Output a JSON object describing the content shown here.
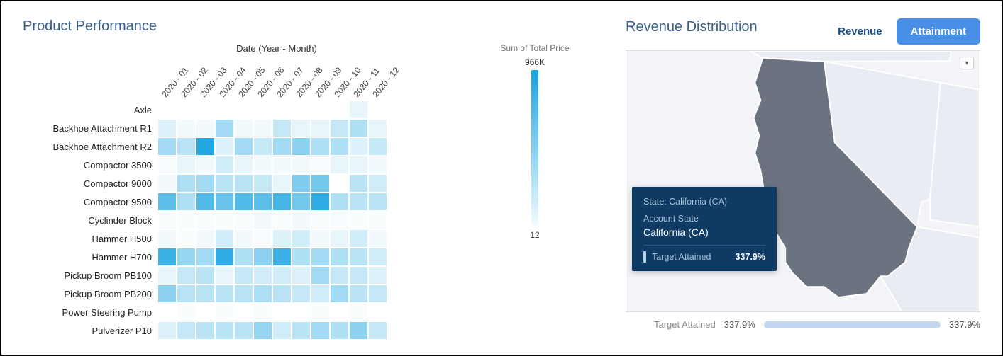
{
  "left_title": "Product Performance",
  "right_title": "Revenue Distribution",
  "toggle": {
    "revenue": "Revenue",
    "attainment": "Attainment"
  },
  "legend": {
    "title": "Sum of Total Price",
    "max": "966K",
    "min": "12"
  },
  "heatmap_top": "Date (Year - Month)",
  "x_labels": [
    "2020 - 01",
    "2020 - 02",
    "2020 - 03",
    "2020 - 04",
    "2020 - 05",
    "2020 - 06",
    "2020 - 07",
    "2020 - 08",
    "2020 - 09",
    "2020 - 10",
    "2020 - 11",
    "2020 - 12"
  ],
  "products": [
    "Axle",
    "Backhoe Attachment R1",
    "Backhoe Attachment R2",
    "Compactor 3500",
    "Compactor 9000",
    "Compactor 9500",
    "Cyclinder Block",
    "Hammer H500",
    "Hammer H700",
    "Pickup Broom PB100",
    "Pickup Broom PB200",
    "Power Steering Pump",
    "Pulverizer P10"
  ],
  "tooltip": {
    "state_line": "State: California (CA)",
    "account_label": "Account State",
    "account_value": "California (CA)",
    "metric_label": "Target Attained",
    "metric_value": "337.9%"
  },
  "bottom": {
    "label": "Target Attained",
    "left": "337.9%",
    "right": "337.9%"
  },
  "chart_data": [
    {
      "type": "heatmap",
      "title": "Product Performance",
      "xlabel": "Date (Year - Month)",
      "ylabel": "",
      "legend_title": "Sum of Total Price",
      "value_range": [
        12,
        966000
      ],
      "x": [
        "2020-01",
        "2020-02",
        "2020-03",
        "2020-04",
        "2020-05",
        "2020-06",
        "2020-07",
        "2020-08",
        "2020-09",
        "2020-10",
        "2020-11",
        "2020-12"
      ],
      "y": [
        "Axle",
        "Backhoe Attachment R1",
        "Backhoe Attachment R2",
        "Compactor 3500",
        "Compactor 9000",
        "Compactor 9500",
        "Cyclinder Block",
        "Hammer H500",
        "Hammer H700",
        "Pickup Broom PB100",
        "Pickup Broom PB200",
        "Power Steering Pump",
        "Pulverizer P10"
      ],
      "z_intensity_0to1": [
        [
          0.0,
          0.0,
          0.0,
          0.0,
          0.0,
          0.0,
          0.0,
          0.0,
          0.0,
          0.0,
          0.1,
          0.0
        ],
        [
          0.15,
          0.05,
          0.05,
          0.4,
          0.05,
          0.05,
          0.25,
          0.1,
          0.1,
          0.25,
          0.35,
          0.1
        ],
        [
          0.4,
          0.3,
          0.95,
          0.15,
          0.4,
          0.25,
          0.4,
          0.5,
          0.35,
          0.35,
          0.15,
          0.25
        ],
        [
          0.03,
          0.1,
          0.05,
          0.2,
          0.1,
          0.05,
          0.05,
          0.05,
          0.03,
          0.1,
          0.1,
          0.05
        ],
        [
          0.05,
          0.35,
          0.4,
          0.3,
          0.3,
          0.25,
          0.1,
          0.55,
          0.6,
          0.0,
          0.3,
          0.2
        ],
        [
          0.7,
          0.35,
          0.75,
          0.65,
          0.75,
          0.7,
          0.8,
          0.6,
          0.9,
          0.35,
          0.3,
          0.3
        ],
        [
          0.02,
          0.02,
          0.02,
          0.02,
          0.02,
          0.05,
          0.02,
          0.05,
          0.02,
          0.03,
          0.02,
          0.02
        ],
        [
          0.05,
          0.02,
          0.05,
          0.2,
          0.05,
          0.03,
          0.15,
          0.2,
          0.05,
          0.1,
          0.2,
          0.05
        ],
        [
          0.85,
          0.45,
          0.4,
          0.9,
          0.35,
          0.5,
          0.85,
          0.35,
          0.4,
          0.35,
          0.3,
          0.2
        ],
        [
          0.1,
          0.25,
          0.3,
          0.1,
          0.25,
          0.2,
          0.2,
          0.15,
          0.4,
          0.25,
          0.25,
          0.15
        ],
        [
          0.5,
          0.3,
          0.3,
          0.3,
          0.3,
          0.35,
          0.3,
          0.25,
          0.2,
          0.4,
          0.3,
          0.25
        ],
        [
          0.0,
          0.02,
          0.0,
          0.02,
          0.0,
          0.02,
          0.0,
          0.0,
          0.02,
          0.0,
          0.02,
          0.0
        ],
        [
          0.15,
          0.25,
          0.3,
          0.3,
          0.3,
          0.45,
          0.2,
          0.3,
          0.4,
          0.35,
          0.5,
          0.25
        ]
      ],
      "note": "z values are estimated relative intensity (0=white,1=darkest blue) mapped to value_range"
    },
    {
      "type": "map",
      "title": "Revenue Distribution",
      "metric": "Target Attained",
      "toggle_options": [
        "Revenue",
        "Attainment"
      ],
      "selected_toggle": "Attainment",
      "highlighted_state": "California (CA)",
      "highlighted_value_pct": 337.9,
      "range_pct": [
        337.9,
        337.9
      ]
    }
  ]
}
